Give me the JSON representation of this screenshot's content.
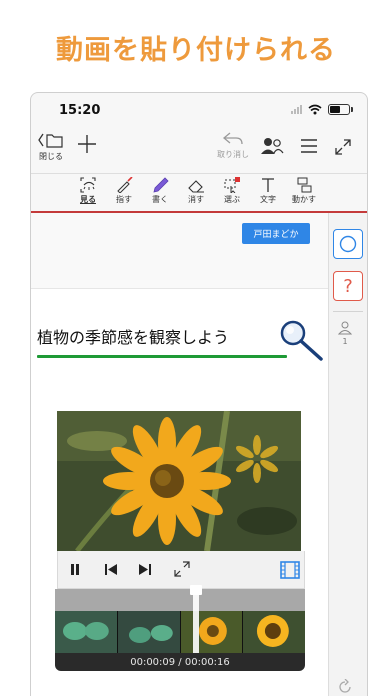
{
  "promo": {
    "title": "動画を貼り付けられる"
  },
  "status_bar": {
    "time": "15:20"
  },
  "toolbar": {
    "close_label": "閉じる",
    "undo_label": "取り消し"
  },
  "tools": [
    {
      "label": "見る",
      "icon": "view-icon"
    },
    {
      "label": "指す",
      "icon": "pointer-pen-icon"
    },
    {
      "label": "書く",
      "icon": "pen-icon"
    },
    {
      "label": "消す",
      "icon": "eraser-icon"
    },
    {
      "label": "選ぶ",
      "icon": "select-icon"
    },
    {
      "label": "文字",
      "icon": "text-icon"
    },
    {
      "label": "動かす",
      "icon": "move-icon"
    }
  ],
  "canvas": {
    "name_tag": "戸田まどか",
    "heading": "植物の季節感を観察しよう"
  },
  "video": {
    "time": "00:00:09 / 00:00:16",
    "progress": 0.5625
  },
  "right_panel": {
    "question_mark": "?",
    "user_count": "1"
  },
  "colors": {
    "promo": "#ee9a3c",
    "accent_blue": "#2f86e6",
    "red_line": "#c43a3a",
    "green_underline": "#1e9a35"
  }
}
